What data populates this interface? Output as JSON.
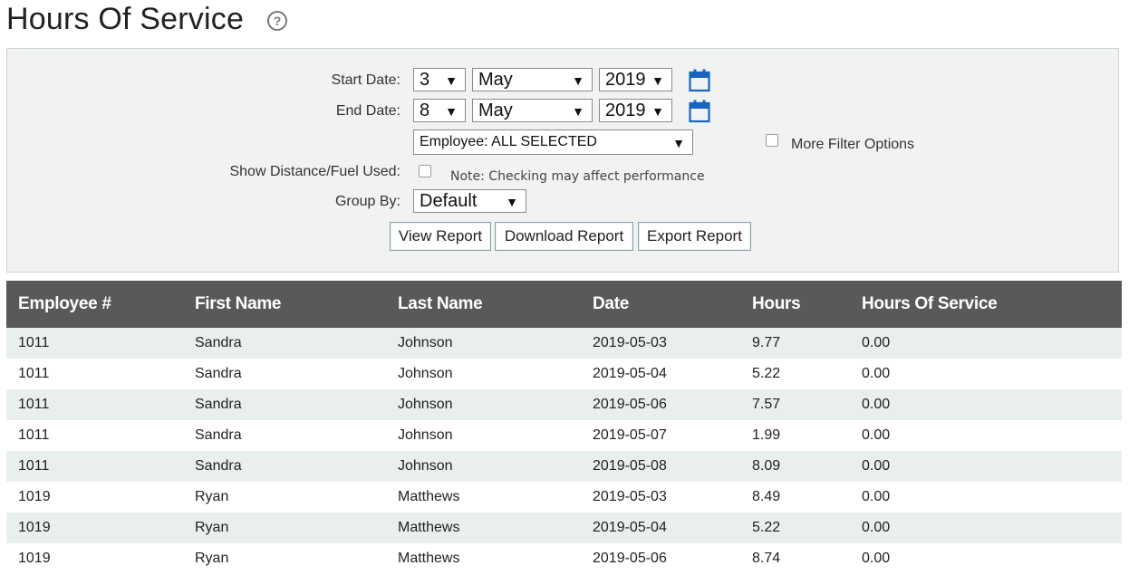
{
  "page": {
    "title": "Hours Of Service",
    "help_icon": "question-circle-icon"
  },
  "filters": {
    "start_date": {
      "label": "Start Date:",
      "day": "3",
      "month": "May",
      "year": "2019"
    },
    "end_date": {
      "label": "End Date:",
      "day": "8",
      "month": "May",
      "year": "2019"
    },
    "employee": {
      "value": "Employee: ALL SELECTED"
    },
    "more_filter_options": {
      "label": "More Filter Options"
    },
    "show_distance": {
      "label": "Show Distance/Fuel Used:",
      "note": "Note: Checking may affect performance"
    },
    "group_by": {
      "label": "Group By:",
      "value": "Default"
    },
    "calendar_icon": "calendar-icon",
    "accent_color": "#1565c0"
  },
  "actions": {
    "view": "View Report",
    "download": "Download Report",
    "export": "Export Report"
  },
  "table": {
    "columns": [
      "Employee #",
      "First Name",
      "Last Name",
      "Date",
      "Hours",
      "Hours Of Service"
    ],
    "rows": [
      [
        "1011",
        "Sandra",
        "Johnson",
        "2019-05-03",
        "9.77",
        "0.00"
      ],
      [
        "1011",
        "Sandra",
        "Johnson",
        "2019-05-04",
        "5.22",
        "0.00"
      ],
      [
        "1011",
        "Sandra",
        "Johnson",
        "2019-05-06",
        "7.57",
        "0.00"
      ],
      [
        "1011",
        "Sandra",
        "Johnson",
        "2019-05-07",
        "1.99",
        "0.00"
      ],
      [
        "1011",
        "Sandra",
        "Johnson",
        "2019-05-08",
        "8.09",
        "0.00"
      ],
      [
        "1019",
        "Ryan",
        "Matthews",
        "2019-05-03",
        "8.49",
        "0.00"
      ],
      [
        "1019",
        "Ryan",
        "Matthews",
        "2019-05-04",
        "5.22",
        "0.00"
      ],
      [
        "1019",
        "Ryan",
        "Matthews",
        "2019-05-06",
        "8.74",
        "0.00"
      ]
    ],
    "header_bg": "#58595b"
  }
}
